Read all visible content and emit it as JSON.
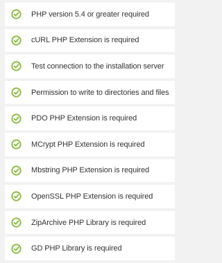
{
  "requirements": {
    "icon": "check-circle-icon",
    "icon_color": "#8cba3b",
    "items": [
      {
        "label": "PHP version 5.4 or greater required",
        "status": "passed"
      },
      {
        "label": "cURL PHP Extension is required",
        "status": "passed"
      },
      {
        "label": "Test connection to the installation server",
        "status": "passed"
      },
      {
        "label": "Permission to write to directories and files",
        "status": "passed"
      },
      {
        "label": "PDO PHP Extension is required",
        "status": "passed"
      },
      {
        "label": "MCrypt PHP Extension is required",
        "status": "passed"
      },
      {
        "label": "Mbstring PHP Extension is required",
        "status": "passed"
      },
      {
        "label": "OpenSSL PHP Extension is required",
        "status": "passed"
      },
      {
        "label": "ZipArchive PHP Library is required",
        "status": "passed"
      },
      {
        "label": "GD PHP Library is required",
        "status": "passed"
      }
    ]
  }
}
